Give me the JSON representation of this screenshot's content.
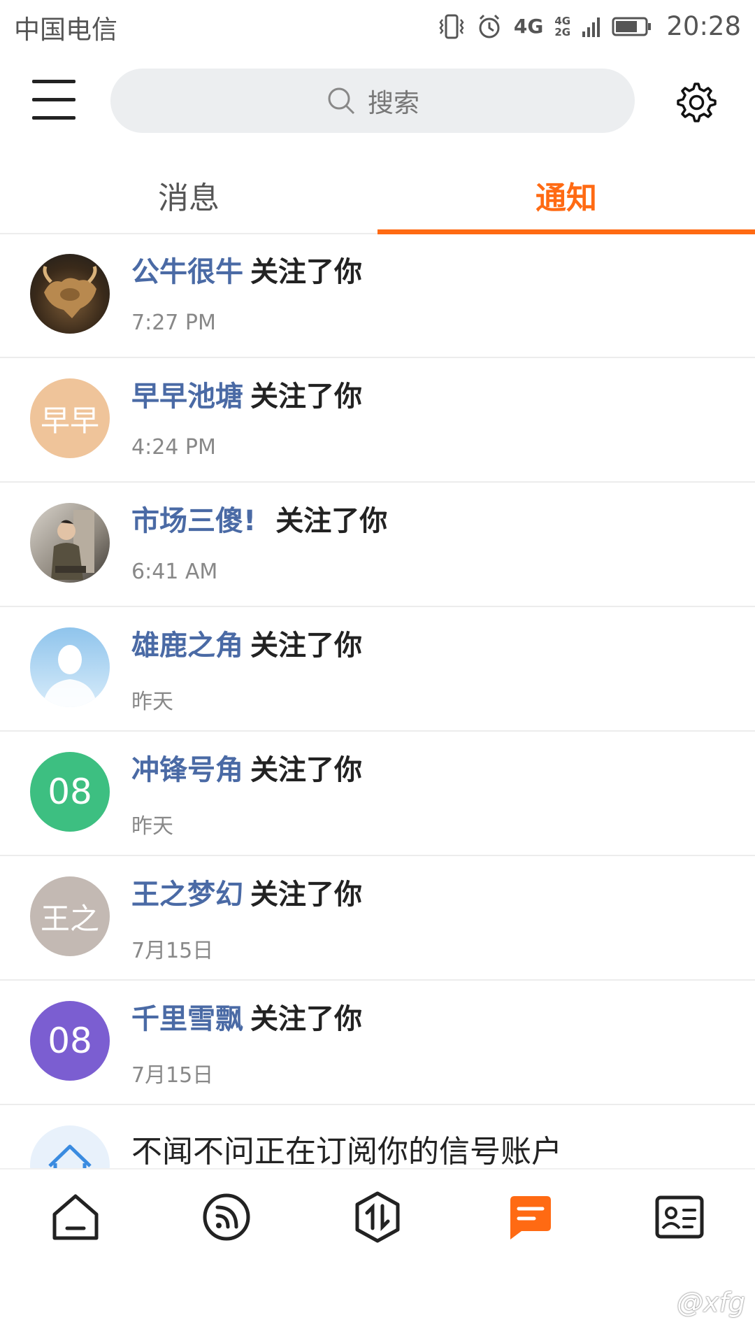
{
  "status_bar": {
    "carrier": "中国电信",
    "network_primary": "4G",
    "network_secondary": "4G 2G",
    "time": "20:28",
    "icons": [
      "vibrate-icon",
      "alarm-icon",
      "network-4g-icon",
      "signal-icon",
      "battery-icon"
    ]
  },
  "header": {
    "menu_icon": "hamburger-menu-icon",
    "search_placeholder": "搜索",
    "settings_icon": "gear-icon"
  },
  "tabs": [
    {
      "label": "消息",
      "active": false
    },
    {
      "label": "通知",
      "active": true
    }
  ],
  "colors": {
    "accent": "#ff6a13",
    "username": "#4a6aa5",
    "divider": "#ececec"
  },
  "notifications": [
    {
      "user": "公牛很牛",
      "action": "关注了你",
      "time": "7:27 PM",
      "avatar": "bull-photo"
    },
    {
      "user": "早早池塘",
      "action": "关注了你",
      "time": "4:24 PM",
      "avatar_text": "早早",
      "avatar_color": "#efc49a"
    },
    {
      "user": "市场三傻!",
      "action": "关注了你",
      "time": "6:41 AM",
      "avatar": "person-photo"
    },
    {
      "user": "雄鹿之角",
      "action": "关注了你",
      "time": "昨天",
      "avatar": "default-person-icon"
    },
    {
      "user": "冲锋号角",
      "action": "关注了你",
      "time": "昨天",
      "avatar_text": "08",
      "avatar_color": "#3dbf81"
    },
    {
      "user": "王之梦幻",
      "action": "关注了你",
      "time": "7月15日",
      "avatar_text": "王之",
      "avatar_color": "#c3b9b3"
    },
    {
      "user": "千里雪飘",
      "action": "关注了你",
      "time": "7月15日",
      "avatar_text": "08",
      "avatar_color": "#7b5ed1"
    },
    {
      "text": "不闻不问正在订阅你的信号账户",
      "avatar": "house-icon"
    }
  ],
  "bottom_nav": [
    {
      "icon": "home-icon",
      "active": false
    },
    {
      "icon": "feed-icon",
      "active": false
    },
    {
      "icon": "trade-icon",
      "active": false
    },
    {
      "icon": "message-icon",
      "active": true
    },
    {
      "icon": "profile-card-icon",
      "active": false
    }
  ],
  "watermark": "@xfg"
}
